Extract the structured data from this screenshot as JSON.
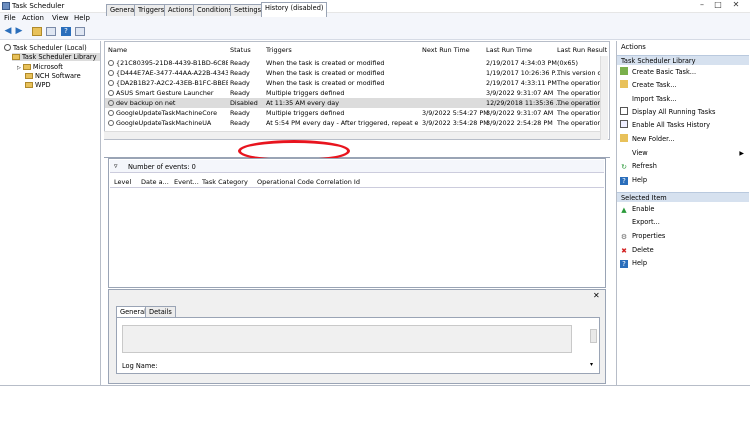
{
  "window": {
    "title": "Task Scheduler"
  },
  "menu": [
    "File",
    "Action",
    "View",
    "Help"
  ],
  "tree": {
    "root": "Task Scheduler (Local)",
    "library": "Task Scheduler Library",
    "children": [
      "Microsoft",
      "NCH Software",
      "WPD"
    ]
  },
  "tasklist": {
    "columns": [
      "Name",
      "Status",
      "Triggers",
      "Next Run Time",
      "Last Run Time",
      "Last Run Result"
    ],
    "rows": [
      {
        "name": "{21C80395-21D8-4439-B1BD-6C8BC...",
        "status": "Ready",
        "triggers": "When the task is created or modified",
        "next": "",
        "last": "2/19/2017 4:34:03 PM",
        "result": "(0x65)"
      },
      {
        "name": "{D444E7AE-3477-44AA-A22B-4343B...",
        "status": "Ready",
        "triggers": "When the task is created or modified",
        "next": "",
        "last": "1/19/2017 10:26:36 P...",
        "result": "This version of"
      },
      {
        "name": "{DA2B1B27-A2C2-43EB-B1FC-BBEB...",
        "status": "Ready",
        "triggers": "When the task is created or modified",
        "next": "",
        "last": "2/19/2017 4:33:11 PM",
        "result": "The operation c"
      },
      {
        "name": "ASUS Smart Gesture Launcher",
        "status": "Ready",
        "triggers": "Multiple triggers defined",
        "next": "",
        "last": "3/9/2022 9:31:07 AM",
        "result": "The operation c"
      },
      {
        "name": "dev backup on net",
        "status": "Disabled",
        "triggers": "At 11:35 AM every day",
        "next": "",
        "last": "12/29/2018 11:35:36 ...",
        "result": "The operation c"
      },
      {
        "name": "GoogleUpdateTaskMachineCore",
        "status": "Ready",
        "triggers": "Multiple triggers defined",
        "next": "3/9/2022 5:54:27 PM",
        "last": "3/9/2022 9:31:07 AM",
        "result": "The operation c"
      },
      {
        "name": "GoogleUpdateTaskMachineUA",
        "status": "Ready",
        "triggers": "At 5:54 PM every day - After triggered, repeat ever...",
        "next": "3/9/2022 3:54:28 PM",
        "last": "3/9/2022 2:54:28 PM",
        "result": "The operation c"
      }
    ]
  },
  "tabs": [
    "General",
    "Triggers",
    "Actions",
    "Conditions",
    "Settings",
    "History (disabled)"
  ],
  "history": {
    "events_label": "Number of events: 0",
    "columns": [
      "Level",
      "Date a...",
      "Event...",
      "Task Category",
      "Operational Code",
      "Correlation Id"
    ]
  },
  "detail": {
    "tabs": [
      "General",
      "Details"
    ],
    "log_name_label": "Log Name:"
  },
  "actions": {
    "header": "Actions",
    "library_section": "Task Scheduler Library",
    "library_items": [
      "Create Basic Task...",
      "Create Task...",
      "Import Task...",
      "Display All Running Tasks",
      "Enable All Tasks History",
      "New Folder...",
      "View",
      "Refresh",
      "Help"
    ],
    "selected_section": "Selected Item",
    "selected_items": [
      "Enable",
      "Export...",
      "Properties",
      "Delete",
      "Help"
    ]
  },
  "colors": {
    "highlight_circle": "#e8141e",
    "section_bg": "#d6e1ef"
  }
}
